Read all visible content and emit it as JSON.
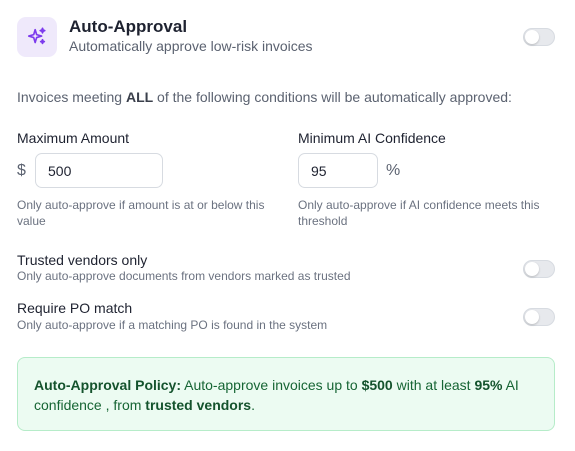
{
  "header": {
    "icon": "sparkles-icon",
    "title": "Auto-Approval",
    "subtitle": "Automatically approve low-risk invoices",
    "enabled": false
  },
  "intro": {
    "before": "Invoices meeting ",
    "emphasis": "ALL",
    "after": " of the following conditions will be automatically approved:"
  },
  "max_amount": {
    "label": "Maximum Amount",
    "prefix": "$",
    "value": "500",
    "help": "Only auto-approve if amount is at or below this value"
  },
  "min_confidence": {
    "label": "Minimum AI Confidence",
    "value": "95",
    "suffix": "%",
    "help": "Only auto-approve if AI confidence meets this threshold"
  },
  "trusted_vendors": {
    "title": "Trusted vendors only",
    "description": "Only auto-approve documents from vendors marked as trusted",
    "enabled": false
  },
  "po_match": {
    "title": "Require PO match",
    "description": "Only auto-approve if a matching PO is found in the system",
    "enabled": false
  },
  "policy": {
    "label": "Auto-Approval Policy:",
    "text1": " Auto-approve invoices up to ",
    "amount": "$500",
    "text2": " with at least ",
    "confidence": "95%",
    "text3": " AI confidence , from ",
    "vendors": "trusted vendors",
    "text4": "."
  },
  "colors": {
    "accent": "#7c3aed",
    "policy_bg": "#ecfbf2",
    "policy_text": "#166534"
  }
}
